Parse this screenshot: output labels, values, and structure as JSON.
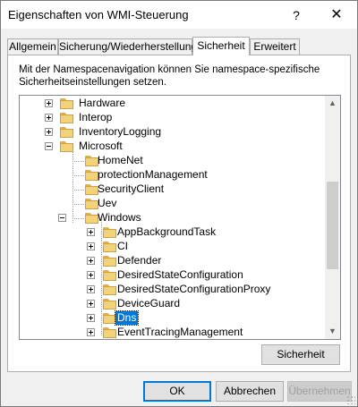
{
  "window": {
    "title": "Eigenschaften von WMI-Steuerung",
    "help_label": "?",
    "close_label": "✕"
  },
  "tabs": [
    {
      "label": "Allgemein"
    },
    {
      "label": "Sicherung/Wiederherstellung"
    },
    {
      "label": "Sicherheit"
    },
    {
      "label": "Erweitert"
    }
  ],
  "active_tab": "Sicherheit",
  "panel": {
    "description": "Mit der Namespacenavigation können Sie namespace-spezifische Sicherheitseinstellungen setzen."
  },
  "tree": {
    "nodes": [
      {
        "label": "Hardware",
        "expander": "plus"
      },
      {
        "label": "Interop",
        "expander": "plus"
      },
      {
        "label": "InventoryLogging",
        "expander": "plus"
      },
      {
        "label": "Microsoft",
        "expander": "minus"
      },
      {
        "label": "HomeNet",
        "expander": "none"
      },
      {
        "label": "protectionManagement",
        "expander": "none"
      },
      {
        "label": "SecurityClient",
        "expander": "none"
      },
      {
        "label": "Uev",
        "expander": "none"
      },
      {
        "label": "Windows",
        "expander": "minus"
      },
      {
        "label": "AppBackgroundTask",
        "expander": "plus"
      },
      {
        "label": "CI",
        "expander": "plus"
      },
      {
        "label": "Defender",
        "expander": "plus"
      },
      {
        "label": "DesiredStateConfiguration",
        "expander": "plus"
      },
      {
        "label": "DesiredStateConfigurationProxy",
        "expander": "plus"
      },
      {
        "label": "DeviceGuard",
        "expander": "plus"
      },
      {
        "label": "Dns",
        "expander": "plus",
        "selected": true
      },
      {
        "label": "EventTracingManagement",
        "expander": "plus"
      }
    ],
    "scroll_up_icon": "▲",
    "scroll_down_icon": "▼"
  },
  "buttons": {
    "security": "Sicherheit",
    "ok": "OK",
    "cancel": "Abbrechen",
    "apply": "Übernehmen"
  },
  "colors": {
    "selection": "#0078d7",
    "folder": "#f3d27a"
  }
}
